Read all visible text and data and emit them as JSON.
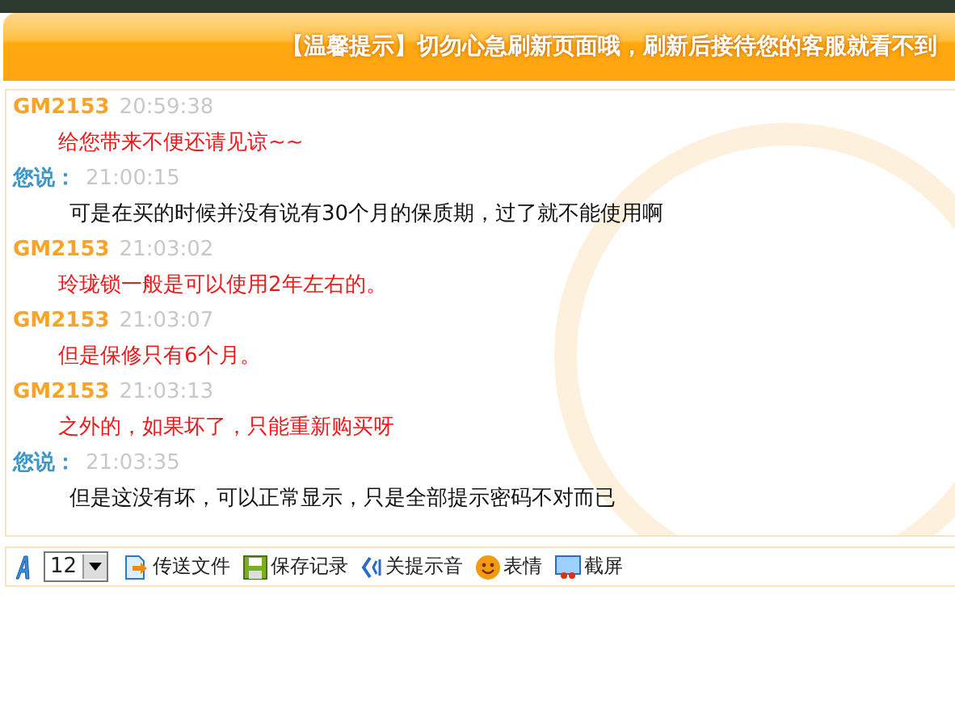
{
  "notice": "【温馨提示】切勿心急刷新页面哦，刷新后接待您的客服就看不到",
  "messages": [
    {
      "kind": "agent",
      "sender": "GM2153",
      "time": "20:59:38",
      "text": "给您带来不便还请见谅~~"
    },
    {
      "kind": "user",
      "sender": "您说：",
      "time": "21:00:15",
      "text": "可是在买的时候并没有说有30个月的保质期，过了就不能使用啊"
    },
    {
      "kind": "agent",
      "sender": "GM2153",
      "time": "21:03:02",
      "text": "玲珑锁一般是可以使用2年左右的。"
    },
    {
      "kind": "agent",
      "sender": "GM2153",
      "time": "21:03:07",
      "text": "但是保修只有6个月。"
    },
    {
      "kind": "agent",
      "sender": "GM2153",
      "time": "21:03:13",
      "text": "之外的，如果坏了，只能重新购买呀"
    },
    {
      "kind": "user",
      "sender": "您说：",
      "time": "21:03:35",
      "text": "但是这没有坏，可以正常显示，只是全部提示密码不对而已"
    }
  ],
  "toolbar": {
    "font_size": "12",
    "buttons": [
      {
        "kind": "send-file",
        "label": "传送文件"
      },
      {
        "kind": "save",
        "label": "保存记录"
      },
      {
        "kind": "sound",
        "label": "关提示音"
      },
      {
        "kind": "emoji",
        "label": "表情"
      },
      {
        "kind": "screenshot",
        "label": "截屏"
      }
    ]
  }
}
